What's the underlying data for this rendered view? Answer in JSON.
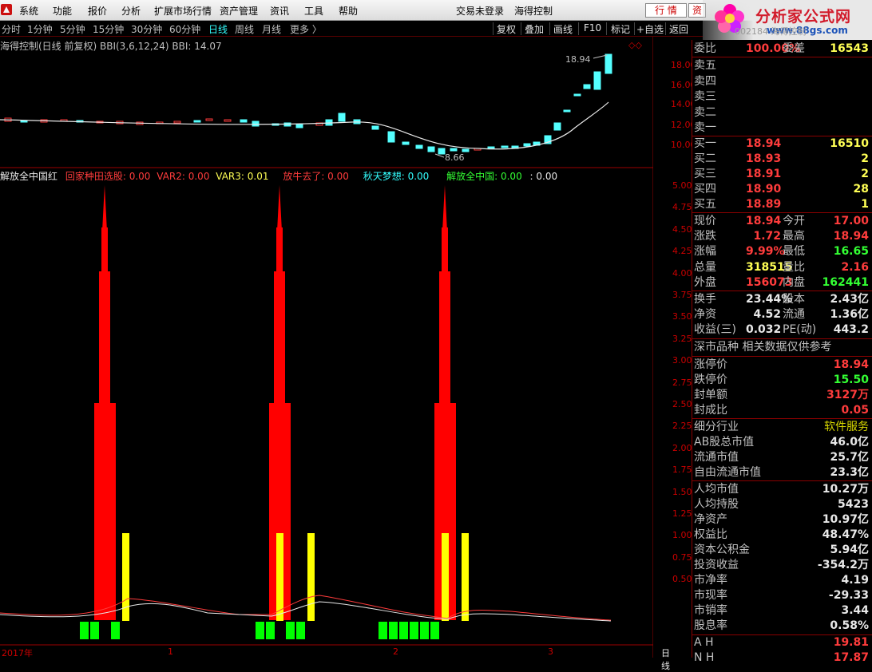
{
  "menu": {
    "items": [
      "系统",
      "功能",
      "报价",
      "分析",
      "扩展市场行情",
      "资产管理",
      "资讯",
      "工具",
      "帮助"
    ],
    "status": "交易未登录",
    "stock": "海得控制",
    "btn_quote": "行 情",
    "btn_info": "资"
  },
  "brand": {
    "title": "分析家公式网",
    "url": "www.88gs.com",
    "watermark": "002184 海得控制"
  },
  "toolbar": {
    "periods": [
      "分时",
      "1分钟",
      "5分钟",
      "15分钟",
      "30分钟",
      "60分钟",
      "日线",
      "周线",
      "月线",
      "更多 〉"
    ],
    "active": "日线",
    "buttons": [
      "复权",
      "叠加",
      "画线",
      "F10",
      "标记",
      "+自选",
      "返回"
    ]
  },
  "main_chart": {
    "title": "海得控制(日线 前复权) BBI(3,6,12,24) BBI: 14.07",
    "high_label": "18.94",
    "low_label": "8.66",
    "y_ticks": [
      "18.00",
      "16.00",
      "14.00",
      "12.00",
      "10.00"
    ]
  },
  "indicator": {
    "name": "解放全中国红",
    "items": [
      {
        "text": "回家种田选股: 0.00",
        "color": "#ff3c3c"
      },
      {
        "text": "VAR2: 0.00",
        "color": "#ff3c3c"
      },
      {
        "text": "VAR3: 0.01",
        "color": "#ffff55"
      },
      {
        "text": "放牛去了: 0.00",
        "color": "#ff3c3c"
      },
      {
        "text": "秋天梦想: 0.00",
        "color": "#3ff"
      },
      {
        "text": "解放全中国: 0.00",
        "color": "#33ff33"
      },
      {
        "text": ": 0.00",
        "color": "#e8e8e8"
      }
    ],
    "y_ticks": [
      "5.00",
      "4.75",
      "4.50",
      "4.25",
      "4.00",
      "3.75",
      "3.50",
      "3.25",
      "3.00",
      "2.75",
      "2.50",
      "2.25",
      "2.00",
      "1.75",
      "1.50",
      "1.25",
      "1.00",
      "0.75",
      "0.50"
    ]
  },
  "dates": {
    "labels": [
      "2017年",
      "1",
      "2",
      "3"
    ],
    "period_tab": "日线"
  },
  "quote": {
    "webi": {
      "k": "委比",
      "v": "100.00%",
      "k2": "委差",
      "v2": "16543"
    },
    "sell": [
      {
        "k": "卖五",
        "p": "",
        "q": ""
      },
      {
        "k": "卖四",
        "p": "",
        "q": ""
      },
      {
        "k": "卖三",
        "p": "",
        "q": ""
      },
      {
        "k": "卖二",
        "p": "",
        "q": ""
      },
      {
        "k": "卖一",
        "p": "",
        "q": ""
      }
    ],
    "buy": [
      {
        "k": "买一",
        "p": "18.94",
        "q": "16510"
      },
      {
        "k": "买二",
        "p": "18.93",
        "q": "2"
      },
      {
        "k": "买三",
        "p": "18.91",
        "q": "2"
      },
      {
        "k": "买四",
        "p": "18.90",
        "q": "28"
      },
      {
        "k": "买五",
        "p": "18.89",
        "q": "1"
      }
    ],
    "stats": [
      {
        "k": "现价",
        "v": "18.94",
        "c1": "red",
        "k2": "今开",
        "v2": "17.00",
        "c2": "red"
      },
      {
        "k": "涨跌",
        "v": "1.72",
        "c1": "red",
        "k2": "最高",
        "v2": "18.94",
        "c2": "red"
      },
      {
        "k": "涨幅",
        "v": "9.99%",
        "c1": "red",
        "k2": "最低",
        "v2": "16.65",
        "c2": "green"
      },
      {
        "k": "总量",
        "v": "318515",
        "c1": "yellow",
        "k2": "量比",
        "v2": "2.16",
        "c2": "red"
      },
      {
        "k": "外盘",
        "v": "156073",
        "c1": "red",
        "k2": "内盘",
        "v2": "162441",
        "c2": "green"
      },
      {
        "k": "换手",
        "v": "23.44%",
        "c1": "white",
        "k2": "股本",
        "v2": "2.43亿",
        "c2": "white"
      },
      {
        "k": "净资",
        "v": "4.52",
        "c1": "white",
        "k2": "流通",
        "v2": "1.36亿",
        "c2": "white"
      },
      {
        "k": "收益(三)",
        "v": "0.032",
        "c1": "white",
        "k2": "PE(动)",
        "v2": "443.2",
        "c2": "white"
      }
    ],
    "market_note": "深市品种  相关数据仅供参考",
    "limits": [
      {
        "k": "涨停价",
        "v": "18.94",
        "c": "red"
      },
      {
        "k": "跌停价",
        "v": "15.50",
        "c": "green"
      },
      {
        "k": "封单额",
        "v": "3127万",
        "c": "red"
      },
      {
        "k": "封成比",
        "v": "0.05",
        "c": "red"
      }
    ],
    "industry": {
      "k": "细分行业",
      "v": "软件服务"
    },
    "caps": [
      {
        "k": "AB股总市值",
        "v": "46.0亿"
      },
      {
        "k": "流通市值",
        "v": "25.7亿"
      },
      {
        "k": "自由流通市值",
        "v": "23.3亿"
      }
    ],
    "finance": [
      {
        "k": "人均市值",
        "v": "10.27万"
      },
      {
        "k": "人均持股",
        "v": "5423"
      },
      {
        "k": "净资产",
        "v": "10.97亿"
      },
      {
        "k": "权益比",
        "v": "48.47%"
      },
      {
        "k": "资本公积金",
        "v": "5.94亿"
      },
      {
        "k": "投资收益",
        "v": "-354.2万"
      },
      {
        "k": "市净率",
        "v": "4.19"
      },
      {
        "k": "市现率",
        "v": "-29.33"
      },
      {
        "k": "市销率",
        "v": "3.44"
      },
      {
        "k": "股息率",
        "v": "0.58%"
      }
    ],
    "ah": [
      {
        "k": "A H",
        "v": "19.81",
        "c": "red"
      },
      {
        "k": "N H",
        "v": "17.87",
        "c": "red"
      }
    ]
  }
}
